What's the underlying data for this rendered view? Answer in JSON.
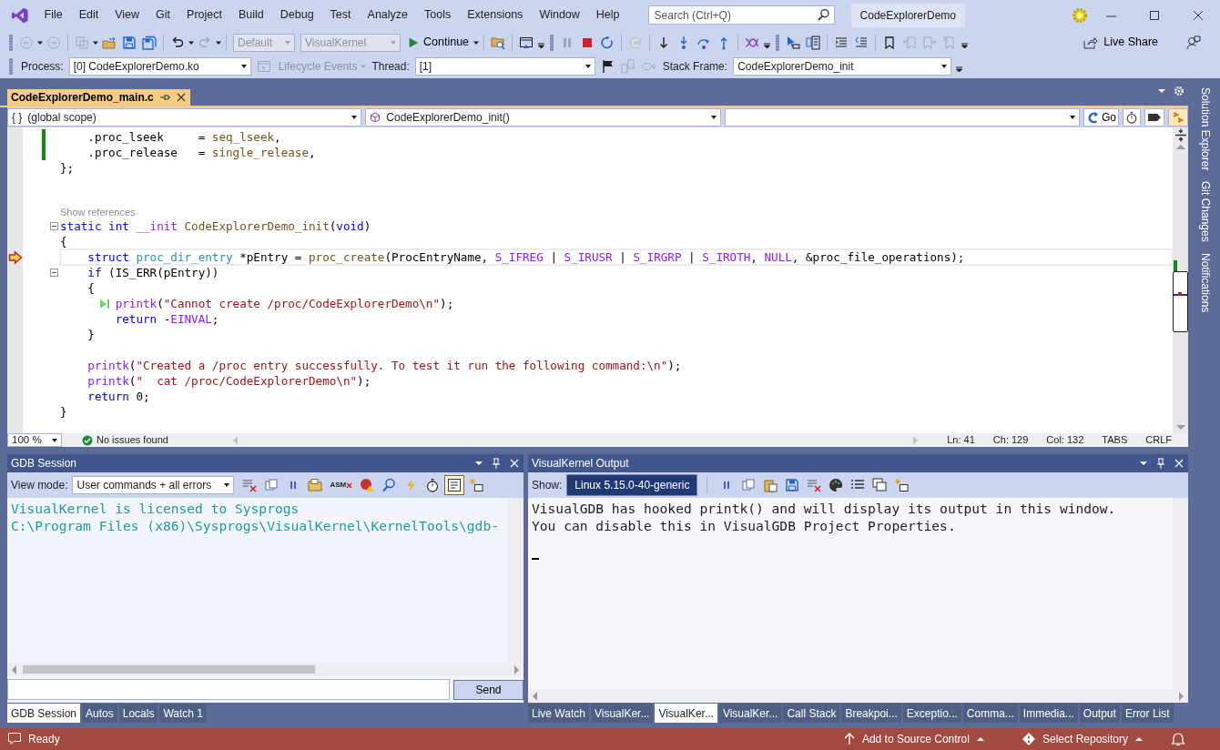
{
  "title_bar": {
    "menu": [
      "File",
      "Edit",
      "View",
      "Git",
      "Project",
      "Build",
      "Debug",
      "Test",
      "Analyze",
      "Tools",
      "Extensions",
      "Window",
      "Help"
    ],
    "search": {
      "placeholder": "Search (Ctrl+Q)"
    },
    "solution": "CodeExplorerDemo"
  },
  "toolbar": {
    "items": [
      {
        "kind": "grip"
      },
      {
        "kind": "back",
        "disabled": true
      },
      {
        "kind": "caret",
        "disabled": false
      },
      {
        "kind": "forward",
        "disabled": true
      },
      {
        "kind": "sep"
      },
      {
        "kind": "new",
        "disabled": true
      },
      {
        "kind": "caret",
        "disabled": false
      },
      {
        "kind": "open",
        "disabled": false
      },
      {
        "kind": "save",
        "disabled": false
      },
      {
        "kind": "saveall",
        "disabled": false
      },
      {
        "kind": "sep"
      },
      {
        "kind": "undo",
        "disabled": false
      },
      {
        "kind": "caret",
        "disabled": false
      },
      {
        "kind": "redo",
        "disabled": true
      },
      {
        "kind": "caret",
        "disabled": false
      },
      {
        "kind": "sep"
      },
      {
        "kind": "select",
        "value": "Default",
        "disabled": true
      },
      {
        "kind": "select",
        "value": "VisualKernel",
        "disabled": true
      },
      {
        "kind": "continue",
        "label": "Continue",
        "disabled": false
      },
      {
        "kind": "sep"
      },
      {
        "kind": "folderfind",
        "disabled": false
      },
      {
        "kind": "sep"
      },
      {
        "kind": "layout",
        "disabled": false
      },
      {
        "kind": "overflow"
      },
      {
        "kind": "grip"
      },
      {
        "kind": "pause",
        "disabled": true
      },
      {
        "kind": "stop",
        "disabled": false
      },
      {
        "kind": "restart",
        "disabled": false
      },
      {
        "kind": "sep"
      },
      {
        "kind": "refresh",
        "disabled": true
      },
      {
        "kind": "sep"
      },
      {
        "kind": "stepdown",
        "disabled": false
      },
      {
        "kind": "stepinto",
        "disabled": false
      },
      {
        "kind": "stepover",
        "disabled": false
      },
      {
        "kind": "stepout",
        "disabled": false
      },
      {
        "kind": "sep"
      },
      {
        "kind": "wave",
        "disabled": false
      },
      {
        "kind": "overflow"
      },
      {
        "kind": "grip"
      },
      {
        "kind": "cursor",
        "disabled": false
      },
      {
        "kind": "threads",
        "disabled": false
      },
      {
        "kind": "sep"
      },
      {
        "kind": "indent",
        "disabled": false
      },
      {
        "kind": "outdent",
        "disabled": false
      },
      {
        "kind": "sep"
      },
      {
        "kind": "bookmark",
        "disabled": false
      },
      {
        "kind": "bmprev",
        "disabled": true
      },
      {
        "kind": "bmnext",
        "disabled": true
      },
      {
        "kind": "bmclear",
        "disabled": true
      },
      {
        "kind": "overflow"
      }
    ],
    "live_share": "Live Share"
  },
  "debug_bar": {
    "items": [
      {
        "kind": "grip"
      },
      {
        "kind": "label",
        "text": "Process:"
      },
      {
        "kind": "select",
        "value": "[0] CodeExplorerDemo.ko",
        "disabled": false
      },
      {
        "kind": "lifecycle",
        "label": "Lifecycle Events",
        "disabled": true
      },
      {
        "kind": "label",
        "text": "Thread:"
      },
      {
        "kind": "select",
        "value": "[1]",
        "disabled": false
      },
      {
        "kind": "flag",
        "disabled": false
      },
      {
        "kind": "blocks",
        "disabled": true
      },
      {
        "kind": "fish",
        "disabled": true
      },
      {
        "kind": "label",
        "text": "Stack Frame:"
      },
      {
        "kind": "select",
        "value": "CodeExplorerDemo_init",
        "disabled": false
      },
      {
        "kind": "overflow"
      }
    ]
  },
  "document_tabs": [
    {
      "label": "CodeExplorerDemo_main.c",
      "selected": true
    }
  ],
  "nav_bar": {
    "scope_icon": "{ }",
    "scope": "(global scope)",
    "member": "CodeExplorerDemo_init()",
    "go": "Go"
  },
  "editor": {
    "lines": [
      {
        "tokens": [
          {
            "kind": "plain",
            "text": "    .proc_lseek     ="
          },
          {
            "kind": "function",
            "text": " seq_lseek"
          },
          {
            "kind": "plain",
            "text": ","
          }
        ],
        "changed": true,
        "fold": false
      },
      {
        "tokens": [
          {
            "kind": "plain",
            "text": "    .proc_release   ="
          },
          {
            "kind": "function",
            "text": " single_release"
          },
          {
            "kind": "plain",
            "text": ","
          }
        ],
        "changed": true,
        "fold": false
      },
      {
        "tokens": [
          {
            "kind": "plain",
            "text": "};"
          }
        ],
        "changed": false,
        "fold": false
      },
      {
        "changed": false,
        "fold": false
      },
      {
        "changed": false,
        "fold": false
      },
      {
        "kind": "codelens",
        "text": "Show references"
      },
      {
        "tokens": [
          {
            "kind": "keyword",
            "text": "static int"
          },
          {
            "kind": "macro",
            "text": " __init"
          },
          {
            "kind": "function",
            "text": " CodeExplorerDemo_init"
          },
          {
            "kind": "plain",
            "text": "("
          },
          {
            "kind": "keyword",
            "text": "void"
          },
          {
            "kind": "plain",
            "text": ")"
          }
        ],
        "changed": false,
        "fold": true
      },
      {
        "tokens": [
          {
            "kind": "plain",
            "text": "{"
          }
        ],
        "changed": false,
        "fold": false
      },
      {
        "tokens": [
          {
            "kind": "keyword",
            "text": "    struct"
          },
          {
            "kind": "type",
            "text": " proc_dir_entry"
          },
          {
            "kind": "plain",
            "text": " *pEntry ="
          },
          {
            "kind": "function",
            "text": " proc_create"
          },
          {
            "kind": "plain",
            "text": "(ProcEntryName,"
          },
          {
            "kind": "macro",
            "text": " S_IFREG"
          },
          {
            "kind": "plain",
            "text": " |"
          },
          {
            "kind": "macro",
            "text": " S_IRUSR"
          },
          {
            "kind": "plain",
            "text": " |"
          },
          {
            "kind": "macro",
            "text": " S_IRGRP"
          },
          {
            "kind": "plain",
            "text": " |"
          },
          {
            "kind": "macro",
            "text": " S_IROTH"
          },
          {
            "kind": "plain",
            "text": ","
          },
          {
            "kind": "macro",
            "text": " NULL"
          },
          {
            "kind": "plain",
            "text": ", &proc_file_operations);"
          }
        ],
        "changed": false,
        "fold": false,
        "kind": "current",
        "highlighted": true
      },
      {
        "tokens": [
          {
            "kind": "keyword",
            "text": "    if"
          },
          {
            "kind": "plain",
            "text": " (IS_ERR(pEntry))"
          }
        ],
        "changed": false,
        "fold": true
      },
      {
        "tokens": [
          {
            "kind": "plain",
            "text": "    {"
          }
        ],
        "changed": false,
        "fold": false
      },
      {
        "tokens": [
          {
            "kind": "macro",
            "text": "        printk"
          },
          {
            "kind": "plain",
            "text": "("
          },
          {
            "kind": "string",
            "text": "\"Cannot create /proc/CodeExplorerDemo\\n\""
          },
          {
            "kind": "plain",
            "text": ");"
          }
        ],
        "changed": false,
        "fold": false,
        "kind": "run"
      },
      {
        "tokens": [
          {
            "kind": "keyword",
            "text": "        return"
          },
          {
            "kind": "plain",
            "text": " -"
          },
          {
            "kind": "macro",
            "text": "EINVAL"
          },
          {
            "kind": "plain",
            "text": ";"
          }
        ],
        "changed": false,
        "fold": false
      },
      {
        "tokens": [
          {
            "kind": "plain",
            "text": "    }"
          }
        ],
        "changed": false,
        "fold": false
      },
      {
        "changed": false,
        "fold": false
      },
      {
        "tokens": [
          {
            "kind": "macro",
            "text": "    printk"
          },
          {
            "kind": "plain",
            "text": "("
          },
          {
            "kind": "string",
            "text": "\"Created a /proc entry successfully. To test it run the following command:\\n\""
          },
          {
            "kind": "plain",
            "text": ");"
          }
        ],
        "changed": false,
        "fold": false
      },
      {
        "tokens": [
          {
            "kind": "macro",
            "text": "    printk"
          },
          {
            "kind": "plain",
            "text": "("
          },
          {
            "kind": "string",
            "text": "\"  cat /proc/CodeExplorerDemo\\n\""
          },
          {
            "kind": "plain",
            "text": ");"
          }
        ],
        "changed": false,
        "fold": false
      },
      {
        "tokens": [
          {
            "kind": "keyword",
            "text": "    return"
          },
          {
            "kind": "plain",
            "text": " 0;"
          }
        ],
        "changed": false,
        "fold": false
      },
      {
        "tokens": [
          {
            "kind": "plain",
            "text": "}"
          }
        ],
        "changed": false,
        "fold": false
      }
    ],
    "zoom": "100 %",
    "issues": "No issues found",
    "position": [
      "Ln: 41",
      "Ch: 129",
      "Col: 132",
      "TABS",
      "CRLF"
    ]
  },
  "side_tabs": [
    "Solution Explorer",
    "Git Changes",
    "Notifications"
  ],
  "gdb_panel": {
    "title": "GDB Session",
    "view_mode_label": "View mode:",
    "view_mode": "User commands + all errors",
    "tools": [
      {
        "kind": "clear",
        "pressed": false
      },
      {
        "kind": "copy",
        "pressed": false
      },
      {
        "kind": "pause",
        "pressed": false
      },
      {
        "kind": "folder",
        "pressed": false
      },
      {
        "kind": "asm",
        "label": "ASM",
        "pressed": false
      },
      {
        "kind": "ballwarn",
        "pressed": false
      },
      {
        "kind": "find",
        "pressed": false
      },
      {
        "kind": "bolt",
        "pressed": false
      },
      {
        "kind": "stopwatch",
        "pressed": false
      },
      {
        "kind": "frame",
        "pressed": true
      },
      {
        "kind": "newwin",
        "pressed": false
      }
    ],
    "output": [
      "VisualKernel is licensed to Sysprogs",
      "C:\\Program Files (x86)\\Sysprogs\\VisualKernel\\KernelTools\\gdb-"
    ],
    "send": "Send",
    "tabs": [
      {
        "label": "GDB Session",
        "selected": true
      },
      {
        "label": "Autos",
        "selected": false
      },
      {
        "label": "Locals",
        "selected": false
      },
      {
        "label": "Watch 1",
        "selected": false
      }
    ]
  },
  "output_panel": {
    "title": "VisualKernel Output",
    "show_label": "Show:",
    "sources": [
      {
        "label": "Linux 5.15.0-40-generic",
        "selected": true
      }
    ],
    "tools": [
      {
        "kind": "pause",
        "pressed": false
      },
      {
        "kind": "copy",
        "pressed": false
      },
      {
        "kind": "paste",
        "pressed": false
      },
      {
        "kind": "save",
        "pressed": false
      },
      {
        "kind": "clear",
        "pressed": false
      },
      {
        "kind": "palette",
        "pressed": false
      },
      {
        "kind": "list",
        "pressed": false
      },
      {
        "kind": "windows",
        "pressed": false
      },
      {
        "kind": "newwin",
        "pressed": false
      }
    ],
    "output": [
      "VisualGDB has hooked printk() and will display its output in this window.",
      "You can disable this in VisualGDB Project Properties."
    ],
    "tabs": [
      {
        "label": "Live Watch",
        "selected": false
      },
      {
        "label": "VisualKer...",
        "selected": false
      },
      {
        "label": "VisualKer...",
        "selected": true
      },
      {
        "label": "VisualKer...",
        "selected": false
      },
      {
        "label": "Call Stack",
        "selected": false
      },
      {
        "label": "Breakpoi...",
        "selected": false
      },
      {
        "label": "Exceptio...",
        "selected": false
      },
      {
        "label": "Comma...",
        "selected": false
      },
      {
        "label": "Immedia...",
        "selected": false
      },
      {
        "label": "Output",
        "selected": false
      },
      {
        "label": "Error List",
        "selected": false
      }
    ]
  },
  "status_bar": {
    "text": "Ready",
    "source_control": "Add to Source Control",
    "repository": "Select Repository"
  }
}
